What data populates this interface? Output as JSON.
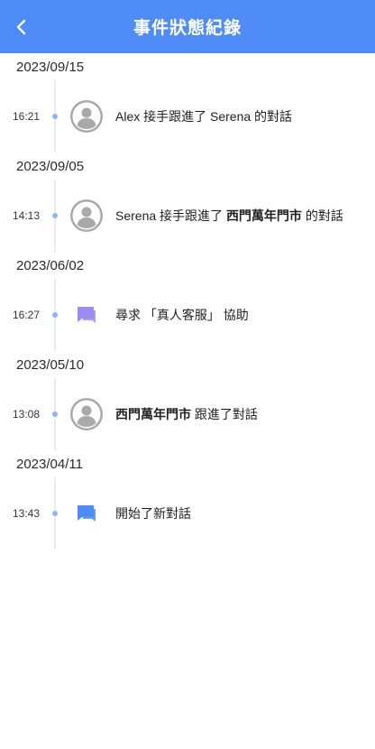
{
  "header": {
    "title": "事件狀態紀錄",
    "back_icon": "chevron-left-icon",
    "bg_color": "#4f8cf6"
  },
  "groups": [
    {
      "date": "2023/09/15",
      "events": [
        {
          "time": "16:21",
          "icon": "avatar",
          "parts": [
            "Alex 接手跟進了 Serena 的對話"
          ]
        }
      ]
    },
    {
      "date": "2023/09/05",
      "events": [
        {
          "time": "14:13",
          "icon": "avatar",
          "parts": [
            "Serena 接手跟進了 ",
            "西門萬年門市",
            " 的對話"
          ]
        }
      ]
    },
    {
      "date": "2023/06/02",
      "events": [
        {
          "time": "16:27",
          "icon": "chat-purple",
          "parts": [
            "尋求 「真人客服」 協助"
          ]
        }
      ]
    },
    {
      "date": "2023/05/10",
      "events": [
        {
          "time": "13:08",
          "icon": "avatar",
          "parts": [
            "西門萬年門市",
            " 跟進了對話"
          ]
        }
      ]
    },
    {
      "date": "2023/04/11",
      "events": [
        {
          "time": "13:43",
          "icon": "chat-blue",
          "parts": [
            "開始了新對話"
          ]
        }
      ]
    }
  ],
  "colors": {
    "accent": "#4f8cf6",
    "chat_purple": "#9b8cf0",
    "chat_blue": "#4f8cf6",
    "avatar": "#a9a9a9"
  }
}
